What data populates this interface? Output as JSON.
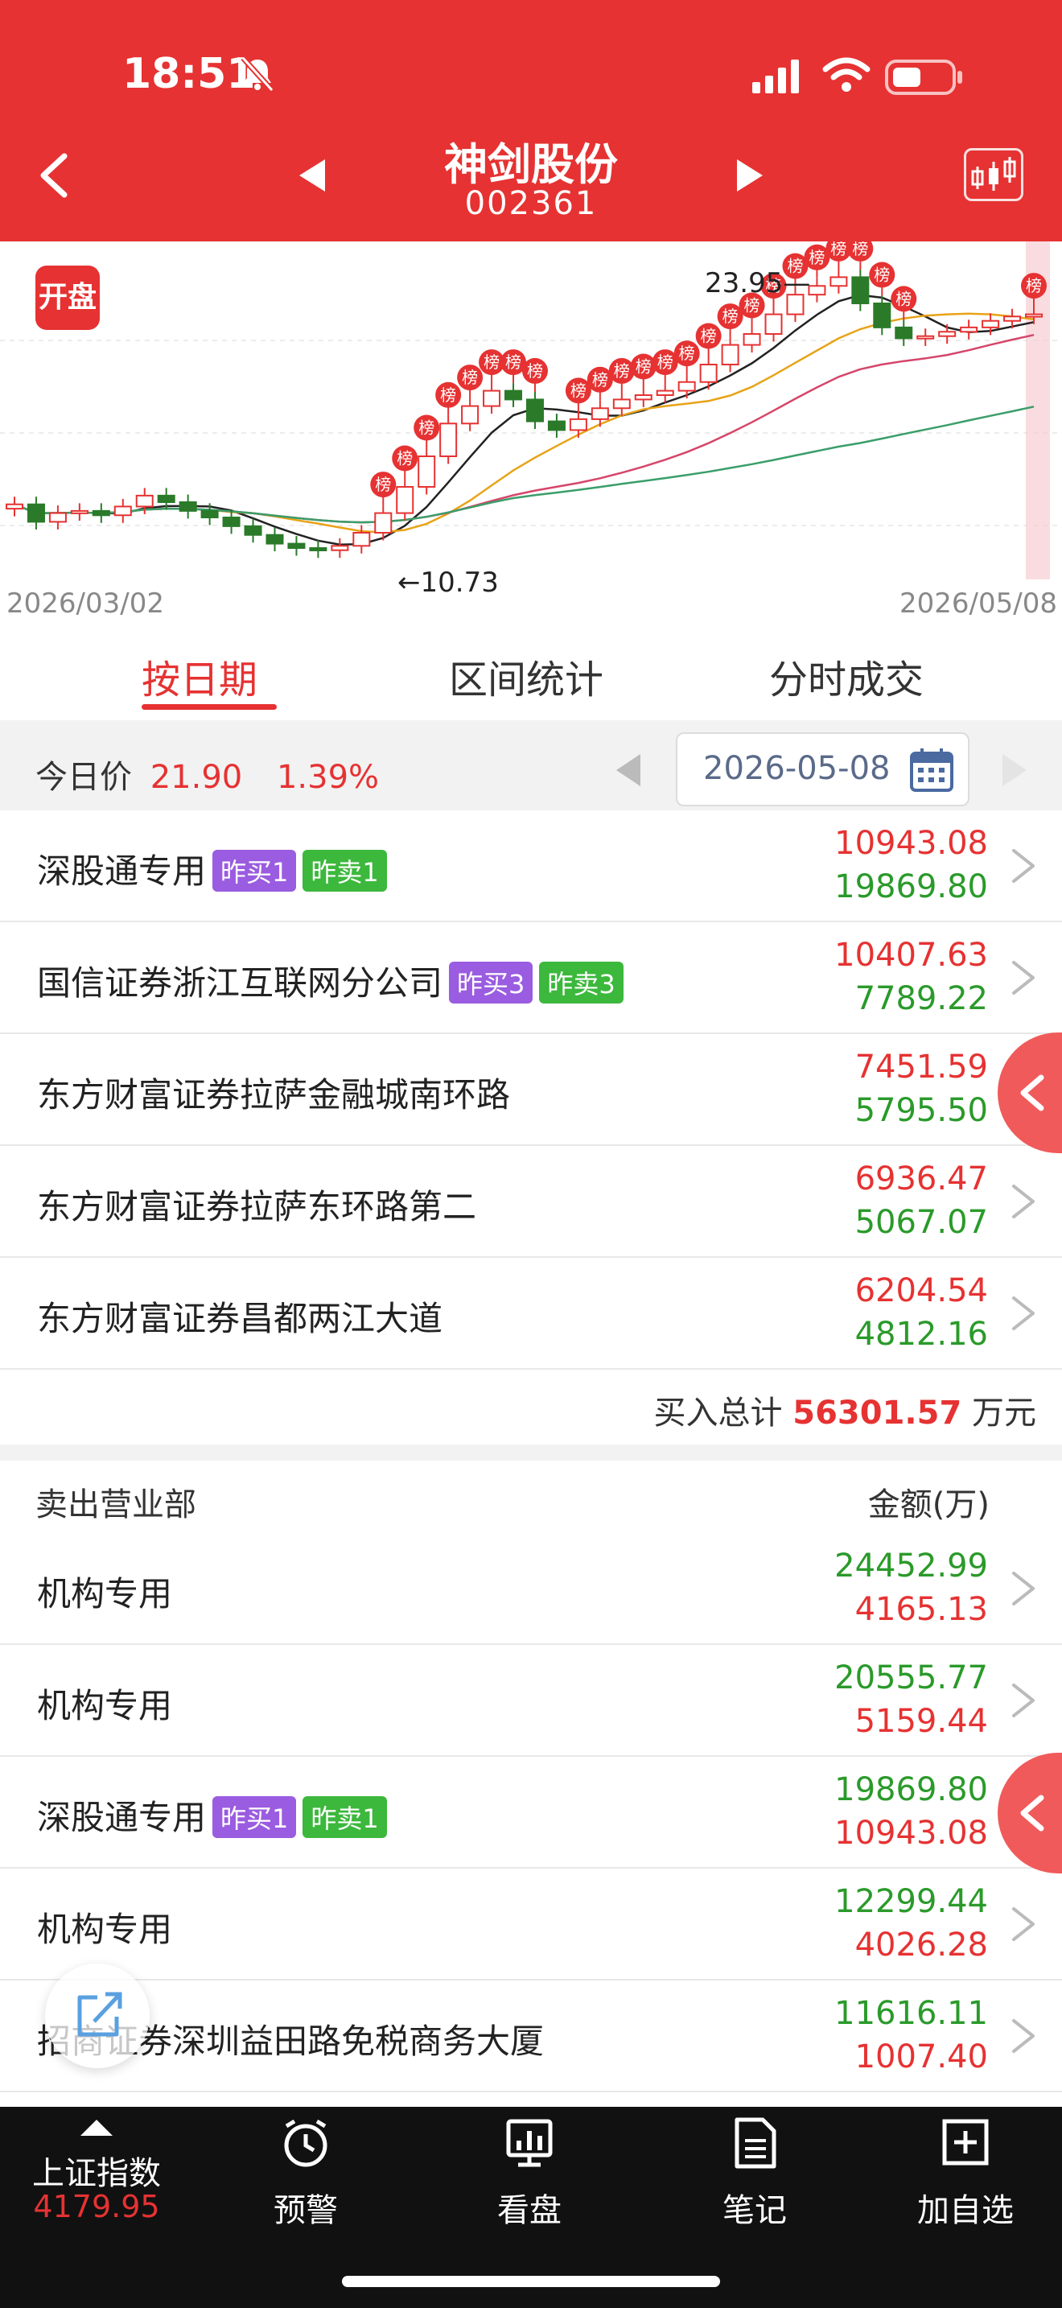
{
  "status": {
    "time": "18:51"
  },
  "header": {
    "title": "神剑股份",
    "code": "002361"
  },
  "chart": {
    "open_badge": "开盘",
    "start_date": "2026/03/02",
    "end_date": "2026/05/08",
    "high_label": "23.95",
    "low_label": "10.73",
    "bang_label": "榜",
    "colors": {
      "up": "#e63232",
      "down": "#2a7a2a",
      "ma5": "#222222",
      "ma10": "#e8a317",
      "ma20": "#d6456a",
      "ma60": "#3a9e6a"
    }
  },
  "tabs": [
    {
      "label": "按日期",
      "active": true
    },
    {
      "label": "区间统计",
      "active": false
    },
    {
      "label": "分时成交",
      "active": false
    }
  ],
  "today": {
    "label": "今日价",
    "price": "21.90",
    "change": "1.39%",
    "date": "2026-05-08"
  },
  "buy_rows": [
    {
      "name": "深股通专用",
      "badges": [
        {
          "text": "昨买1",
          "kind": "p"
        },
        {
          "text": "昨卖1",
          "kind": "g"
        }
      ],
      "buy": "10943.08",
      "sell": "19869.80"
    },
    {
      "name": "国信证券浙江互联网分公司",
      "badges": [
        {
          "text": "昨买3",
          "kind": "p"
        },
        {
          "text": "昨卖3",
          "kind": "g"
        }
      ],
      "buy": "10407.63",
      "sell": "7789.22"
    },
    {
      "name": "东方财富证券拉萨金融城南环路",
      "badges": [],
      "buy": "7451.59",
      "sell": "5795.50"
    },
    {
      "name": "东方财富证券拉萨东环路第二",
      "badges": [],
      "buy": "6936.47",
      "sell": "5067.07"
    },
    {
      "name": "东方财富证券昌都两江大道",
      "badges": [],
      "buy": "6204.54",
      "sell": "4812.16"
    }
  ],
  "buy_total": {
    "label": "买入总计",
    "value": "56301.57",
    "unit": "万元"
  },
  "sell_header": {
    "name_col": "卖出营业部",
    "amount_col": "金额(万)"
  },
  "sell_rows": [
    {
      "name": "机构专用",
      "badges": [],
      "sell": "24452.99",
      "buy": "4165.13"
    },
    {
      "name": "机构专用",
      "badges": [],
      "sell": "20555.77",
      "buy": "5159.44"
    },
    {
      "name": "深股通专用",
      "badges": [
        {
          "text": "昨买1",
          "kind": "p"
        },
        {
          "text": "昨卖1",
          "kind": "g"
        }
      ],
      "sell": "19869.80",
      "buy": "10943.08"
    },
    {
      "name": "机构专用",
      "badges": [],
      "sell": "12299.44",
      "buy": "4026.28"
    },
    {
      "name": "招商证券深圳益田路免税商务大厦",
      "badges": [],
      "sell": "11616.11",
      "buy": "1007.40"
    }
  ],
  "nav": {
    "index_name": "上证指数",
    "index_value": "4179.95",
    "items": [
      {
        "label": "预警",
        "icon": "alarm-clock-icon"
      },
      {
        "label": "看盘",
        "icon": "monitor-chart-icon"
      },
      {
        "label": "笔记",
        "icon": "note-icon"
      },
      {
        "label": "加自选",
        "icon": "add-square-icon"
      }
    ]
  }
}
